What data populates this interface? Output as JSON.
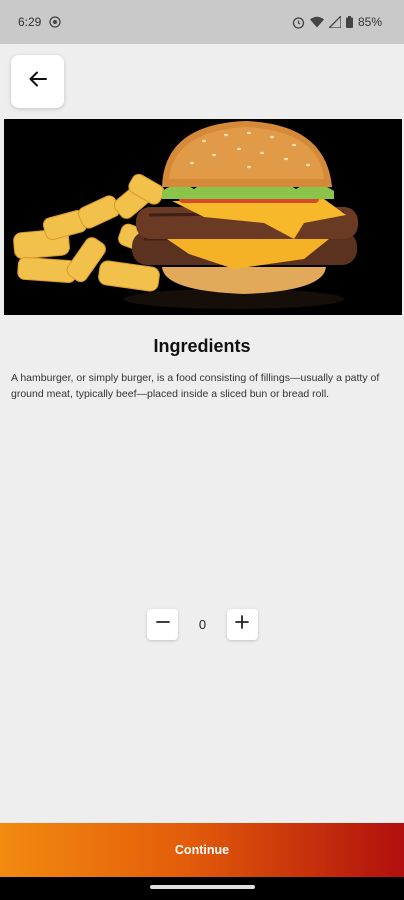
{
  "status_bar": {
    "time": "6:29",
    "battery": "85%",
    "icons": [
      "media-icon",
      "alarm-icon",
      "wifi-icon",
      "signal-icon",
      "battery-icon"
    ]
  },
  "header": {
    "back_icon": "arrow-left-icon"
  },
  "hero": {
    "image_name": "burger-and-fries-image"
  },
  "content": {
    "title": "Ingredients",
    "description": "A hamburger, or simply burger, is a food consisting of fillings—usually a patty of ground meat, typically beef—placed inside a sliced bun or bread roll."
  },
  "quantity": {
    "value": "0",
    "decrement_icon": "minus-icon",
    "increment_icon": "plus-icon"
  },
  "footer": {
    "continue_label": "Continue"
  },
  "colors": {
    "accent_start": "#f28a10",
    "accent_end": "#b10f0d",
    "background": "#eeeeee"
  }
}
